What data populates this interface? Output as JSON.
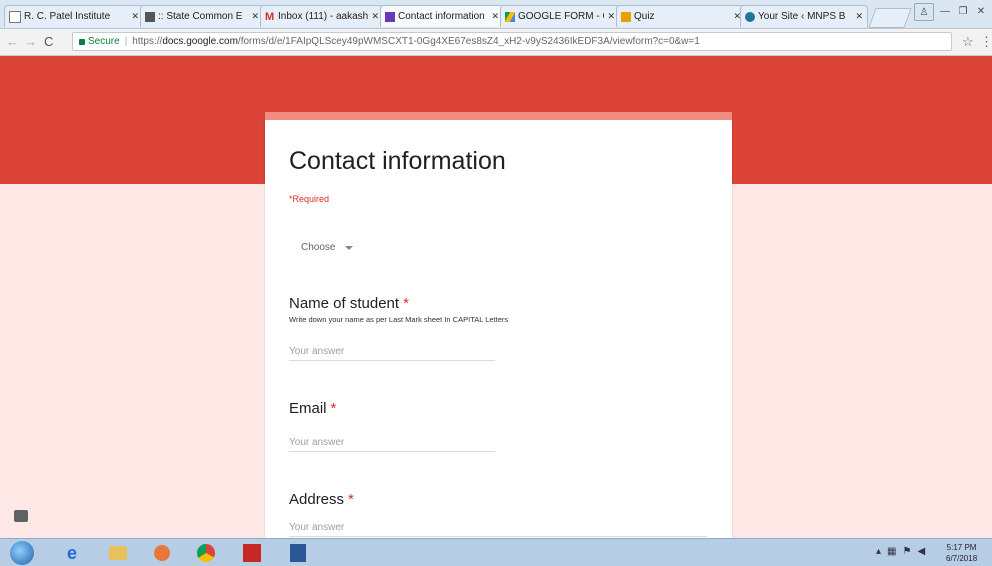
{
  "browser": {
    "tabs": [
      {
        "label": "R. C. Patel Institute",
        "icon": "page-icon",
        "active": false
      },
      {
        "label": ":: State Common E",
        "icon": "gov-icon",
        "active": false
      },
      {
        "label": "Inbox (111) - aakash",
        "icon": "gmail-icon",
        "active": false
      },
      {
        "label": "Contact information",
        "icon": "forms-icon",
        "active": true
      },
      {
        "label": "GOOGLE FORM - G",
        "icon": "drive-icon",
        "active": false
      },
      {
        "label": "Quiz",
        "icon": "quiz-icon",
        "active": false
      },
      {
        "label": "Your Site ‹ MNPS B",
        "icon": "wordpress-icon",
        "active": false
      }
    ],
    "secure_label": "Secure",
    "url_prefix": "https://",
    "url_host": "docs.google.com",
    "url_path": "/forms/d/e/1FAIpQLScey49pWMSCXT1-0Gg4XE67es8sZ4_xH2-v9yS2436IkEDF3A/viewform?c=0&w=1"
  },
  "form": {
    "title": "Contact information",
    "required_note": "*Required",
    "dropdown_value": "Choose",
    "questions": [
      {
        "title": "Name of student",
        "required_mark": "*",
        "description": "Write down your name as per Last Mark sheet In CAPITAL Letters",
        "placeholder": "Your answer"
      },
      {
        "title": "Email",
        "required_mark": "*",
        "description": "",
        "placeholder": "Your answer"
      },
      {
        "title": "Address",
        "required_mark": "*",
        "description": "",
        "placeholder": "Your answer"
      }
    ]
  },
  "taskbar": {
    "apps": [
      "ie-icon",
      "explorer-icon",
      "outlook-icon",
      "chrome-icon",
      "acrobat-icon",
      "word-icon"
    ],
    "time": "5:17 PM",
    "date": "6/7/2018"
  },
  "colors": {
    "accent": "#db4437",
    "card_top": "#f28b82",
    "background": "#fde8e6",
    "required": "#d93025"
  }
}
